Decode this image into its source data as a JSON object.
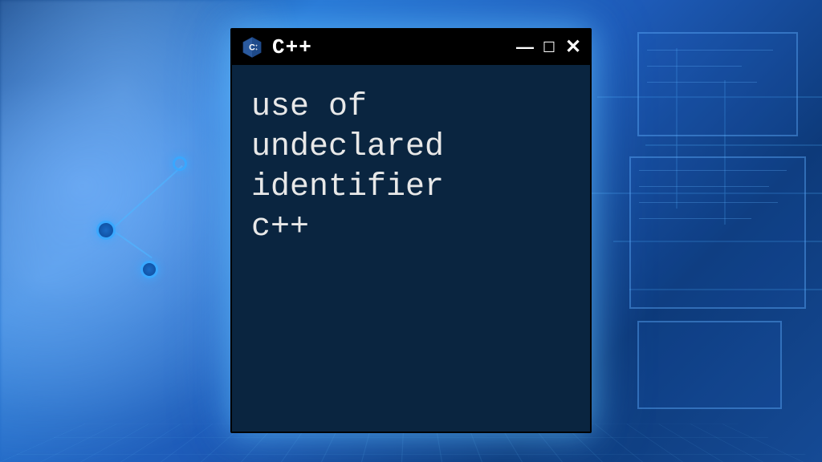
{
  "window": {
    "title": "C++",
    "icon_name": "cpp-hex-icon"
  },
  "content": {
    "text": "use of\nundeclared\nidentifier\nc++"
  },
  "colors": {
    "terminal_bg": "#0a2540",
    "titlebar_bg": "#000000",
    "text": "#e8e8e8",
    "accent": "#3aa8ff"
  }
}
